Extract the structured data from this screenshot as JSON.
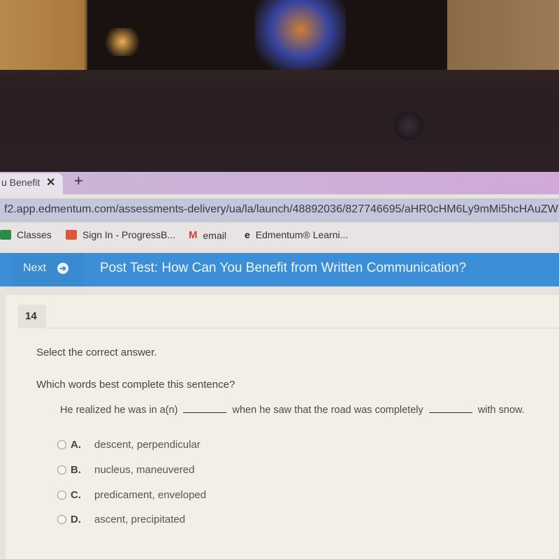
{
  "browser": {
    "tab": {
      "title": "u Benefit",
      "close_icon": "close-icon"
    },
    "new_tab_icon": "plus-icon",
    "url": "f2.app.edmentum.com/assessments-delivery/ua/la/launch/48892036/827746695/aHR0cHM6Ly9mMi5hcHAuZW",
    "bookmarks": [
      {
        "label": "Classes",
        "icon": "classroom-icon",
        "color": "#2e8a4a"
      },
      {
        "label": "Sign In - ProgressB...",
        "icon": "family-icon",
        "color": "#d9593a"
      },
      {
        "label": "email",
        "icon": "gmail-icon",
        "color": "#d04437"
      },
      {
        "label": "Edmentum® Learni...",
        "icon": "edmentum-icon",
        "color": "#222222"
      }
    ]
  },
  "toolbar": {
    "next_label": "Next",
    "next_icon": "arrow-right-circle-icon",
    "title": "Post Test: How Can You Benefit from Written Communication?",
    "accent": "#3c8fd6"
  },
  "question": {
    "number": "14",
    "instruction": "Select the correct answer.",
    "prompt": "Which words best complete this sentence?",
    "sentence_parts": [
      "He realized he was in a(n)",
      "when he saw that the road was completely",
      "with snow."
    ],
    "choices": [
      {
        "letter": "A.",
        "text": "descent, perpendicular"
      },
      {
        "letter": "B.",
        "text": "nucleus, maneuvered"
      },
      {
        "letter": "C.",
        "text": "predicament, enveloped"
      },
      {
        "letter": "D.",
        "text": "ascent, precipitated"
      }
    ]
  }
}
